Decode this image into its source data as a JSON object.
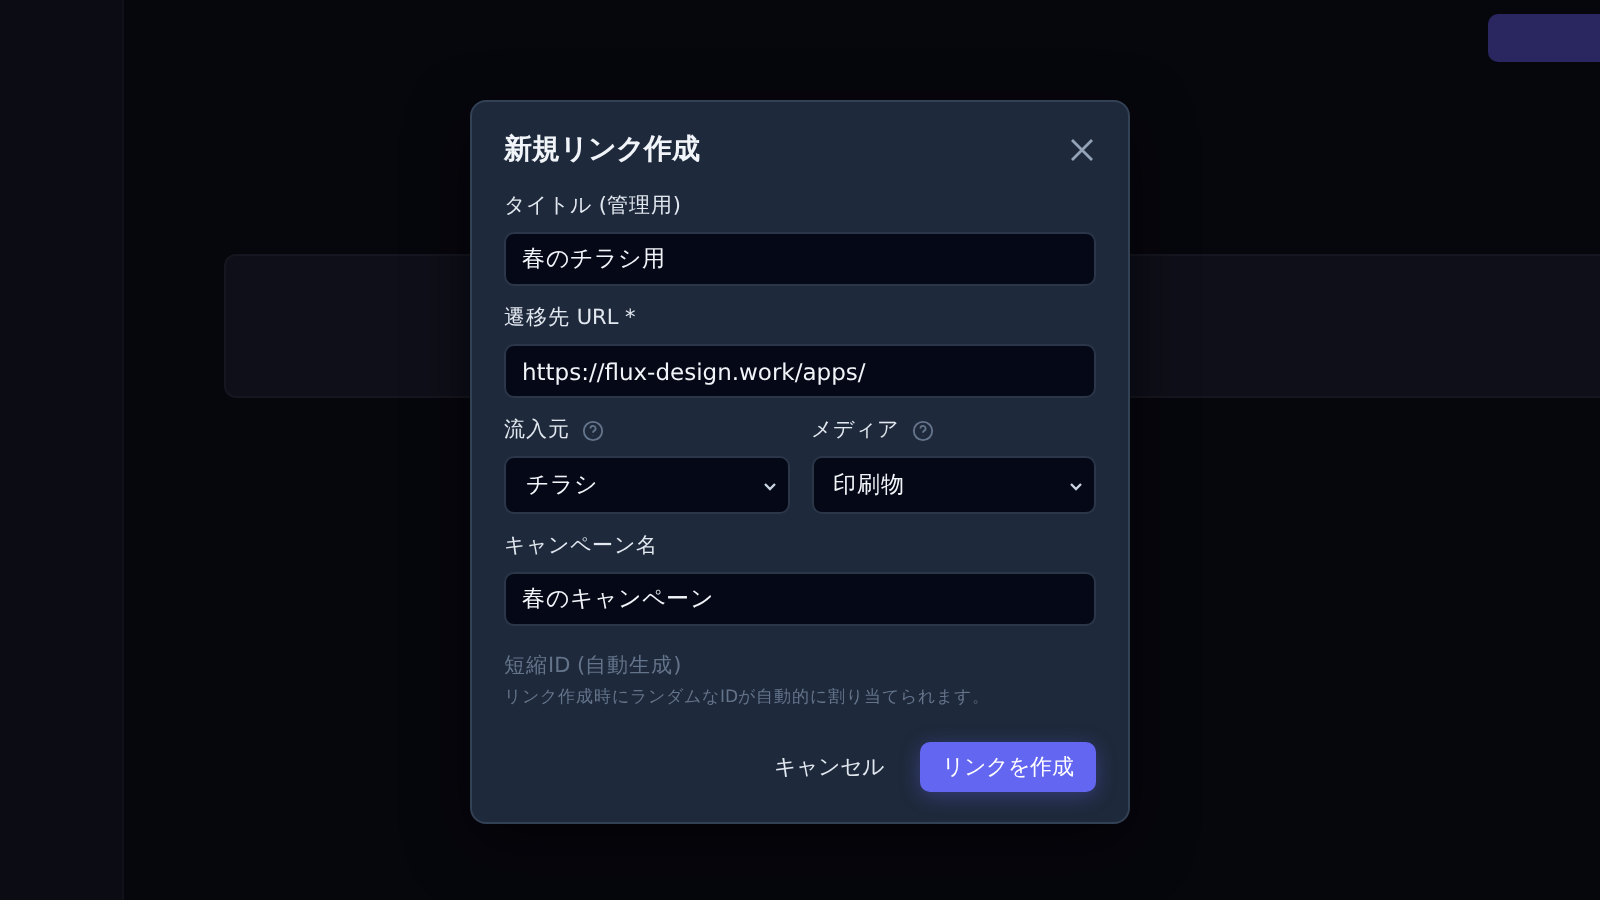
{
  "dialog": {
    "title": "新規リンク作成",
    "fields": [
      {
        "kind": "text",
        "label": "タイトル (管理用)",
        "value": "春のチラシ用"
      },
      {
        "kind": "text",
        "label": "遷移先 URL *",
        "value": "https://flux-design.work/apps/"
      },
      {
        "kind": "select_pair",
        "items": [
          {
            "label": "流入元",
            "value": "チラシ",
            "help": true
          },
          {
            "label": "メディア",
            "value": "印刷物",
            "help": true
          }
        ]
      },
      {
        "kind": "text",
        "label": "キャンペーン名",
        "value": "春のキャンペーン"
      }
    ],
    "info": {
      "title": "短縮ID (自動生成)",
      "description": "リンク作成時にランダムなIDが自動的に割り当てられます。"
    },
    "buttons": [
      {
        "kind": "secondary",
        "label": "キャンセル"
      },
      {
        "kind": "primary",
        "label": "リンクを作成"
      }
    ]
  }
}
